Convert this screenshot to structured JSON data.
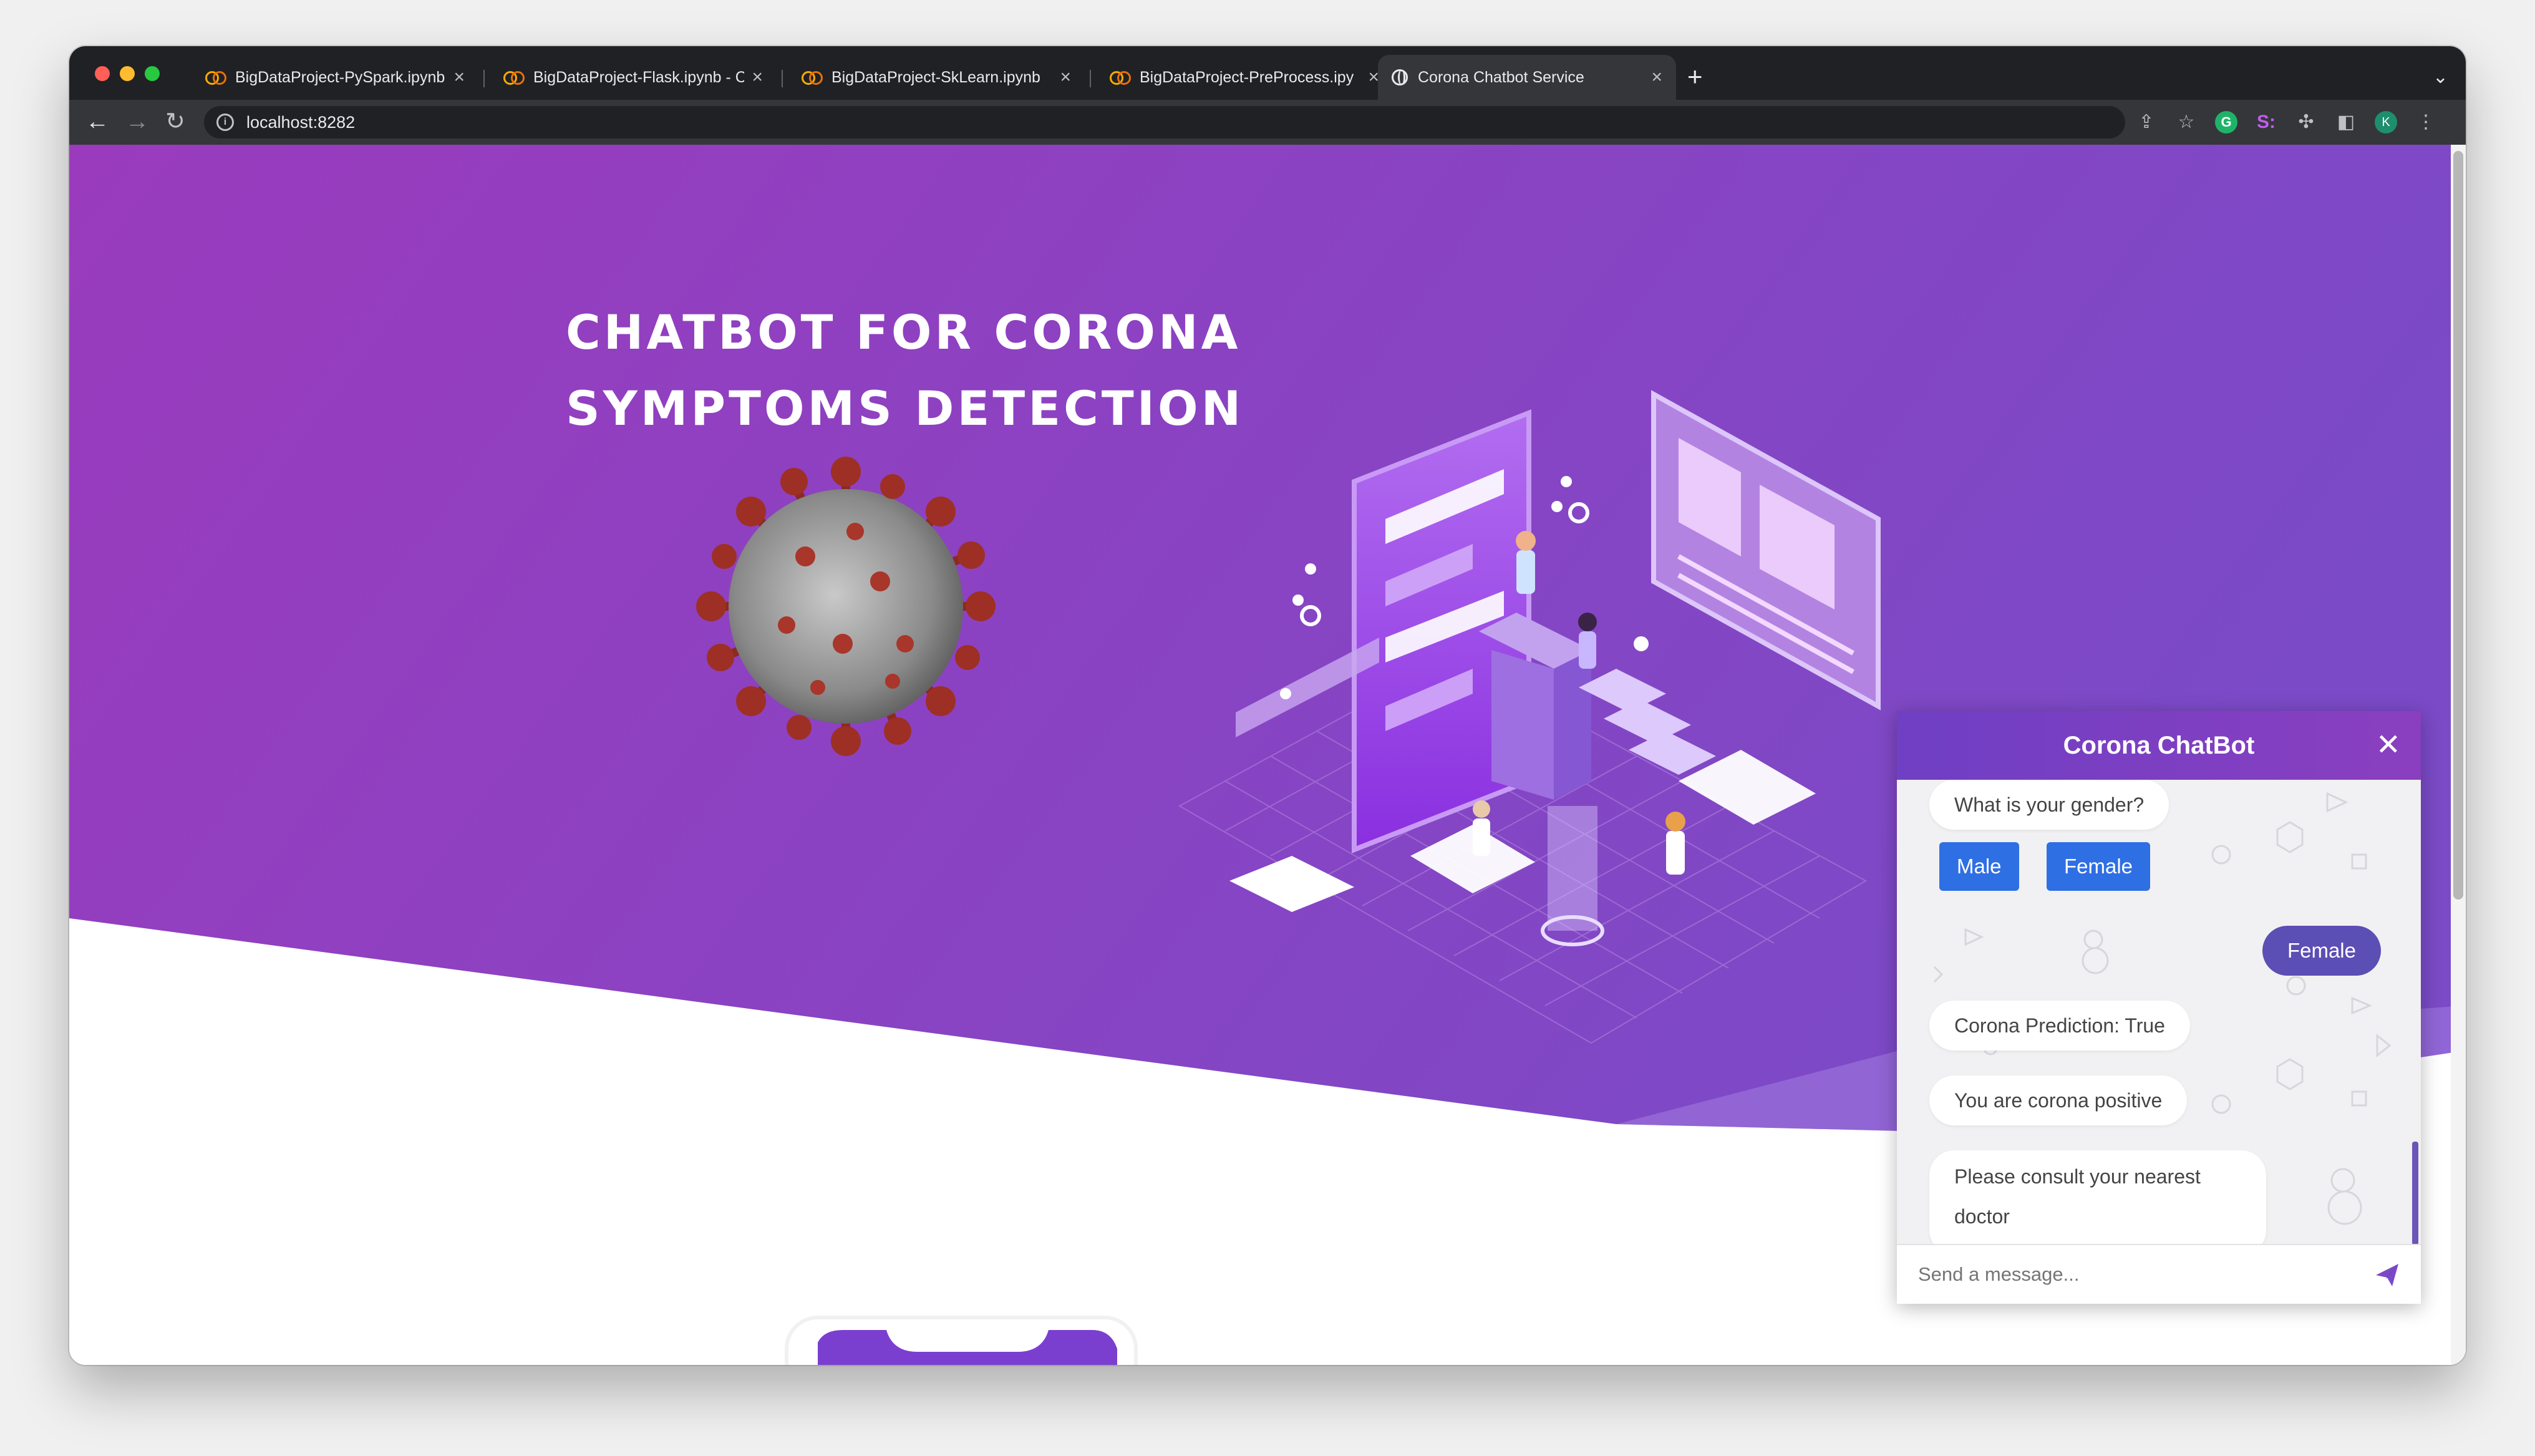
{
  "browser": {
    "tabs": [
      {
        "title": "BigDataProject-PySpark.ipynb"
      },
      {
        "title": "BigDataProject-Flask.ipynb - C"
      },
      {
        "title": "BigDataProject-SkLearn.ipynb"
      },
      {
        "title": "BigDataProject-PreProcess.ipy"
      },
      {
        "title": "Corona Chatbot Service"
      }
    ],
    "url": "localhost:8282",
    "profile_initial": "K",
    "ext_grammarly": "G",
    "ext_s": "S:"
  },
  "hero": {
    "title_line1": "Chatbot for Corona",
    "title_line2": "Symptoms Detection"
  },
  "chatbot": {
    "title": "Corona ChatBot",
    "close_glyph": "✕",
    "messages": {
      "bot_gender_question": "What is your gender?",
      "option_male": "Male",
      "option_female": "Female",
      "user_reply": "Female",
      "bot_prediction": "Corona Prediction: True",
      "bot_result": "You are corona positive",
      "bot_advice": "Please consult your nearest doctor"
    },
    "input_placeholder": "Send a message..."
  },
  "colors": {
    "hero_gradient_start": "#9a3fbf",
    "hero_gradient_end": "#7a4ac6",
    "user_bubble": "#5b4eb4",
    "option_button": "#2f6fe4"
  }
}
